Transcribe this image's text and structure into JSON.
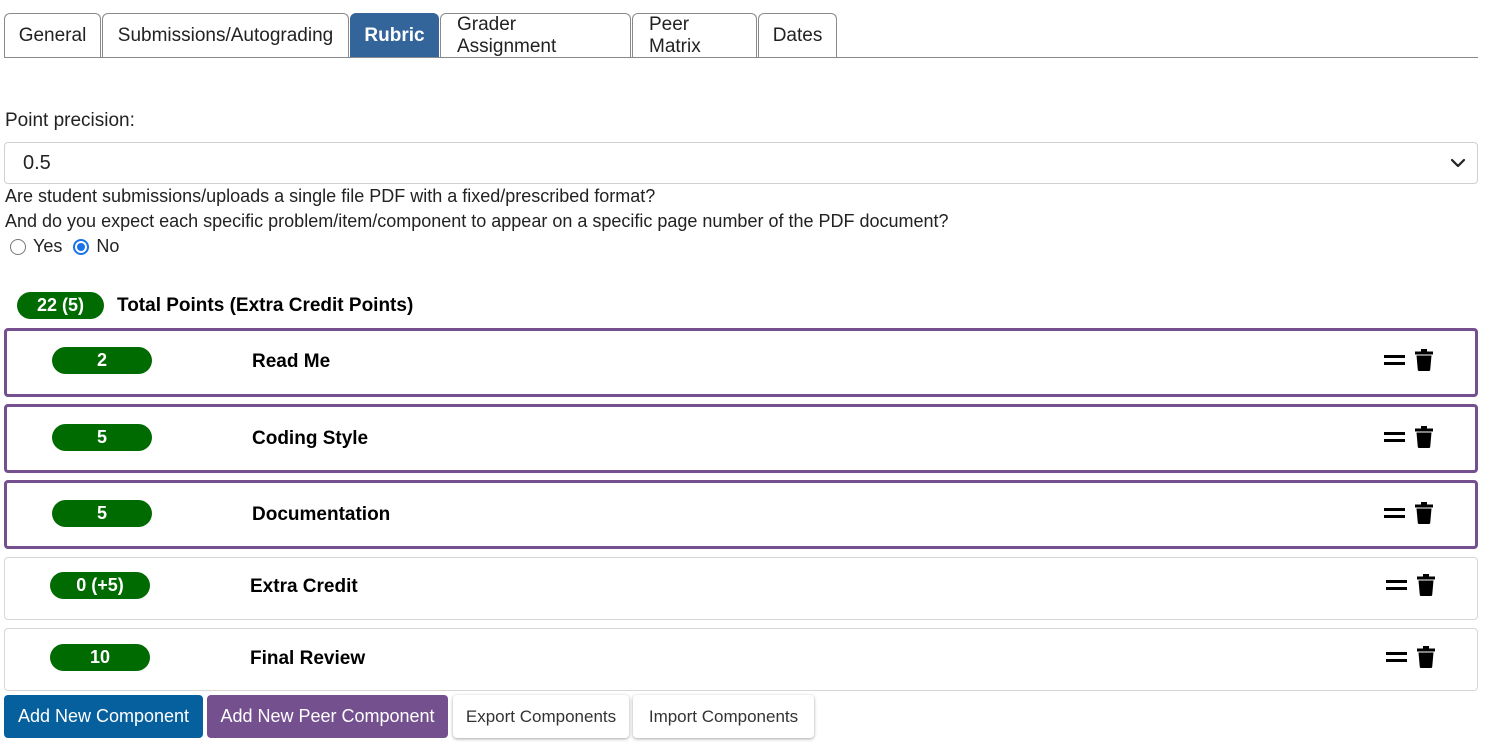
{
  "tabs": [
    {
      "label": "General",
      "active": false
    },
    {
      "label": "Submissions/Autograding",
      "active": false
    },
    {
      "label": "Rubric",
      "active": true
    },
    {
      "label": "Grader Assignment",
      "active": false
    },
    {
      "label": "Peer Matrix",
      "active": false
    },
    {
      "label": "Dates",
      "active": false
    }
  ],
  "point_precision": {
    "label": "Point precision:",
    "value": "0.5"
  },
  "pdf_question": {
    "line1": "Are student submissions/uploads a single file PDF with a fixed/prescribed format?",
    "line2": "And do you expect each specific problem/item/component to appear on a specific page number of the PDF document?",
    "options": [
      "Yes",
      "No"
    ],
    "selected": "No"
  },
  "totals": {
    "points": "22 (5)",
    "label": "Total Points (Extra Credit Points)"
  },
  "components": [
    {
      "points": "2",
      "title": "Read Me",
      "highlighted": true
    },
    {
      "points": "5",
      "title": "Coding Style",
      "highlighted": true
    },
    {
      "points": "5",
      "title": "Documentation",
      "highlighted": true
    },
    {
      "points": "0 (+5)",
      "title": "Extra Credit",
      "highlighted": false
    },
    {
      "points": "10",
      "title": "Final Review",
      "highlighted": false
    }
  ],
  "buttons": {
    "add_component": "Add New Component",
    "add_peer_component": "Add New Peer Component",
    "export": "Export Components",
    "import": "Import Components"
  },
  "colors": {
    "tab_active": "#33649a",
    "points_pill": "#006b00",
    "highlight_border": "#74508f",
    "add_component": "#06609e",
    "add_peer_component": "#74508f",
    "radio_selected": "#1a73e8"
  }
}
